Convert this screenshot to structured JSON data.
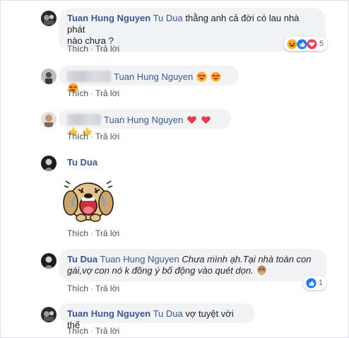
{
  "labels": {
    "like": "Thích",
    "reply": "Trả lời",
    "separator": "·"
  },
  "comments": [
    {
      "author": "Tuan Hung Nguyen",
      "mention": "Tu Dua",
      "text_line1": "thằng anh cả đời có lau nhà phát",
      "text_line2": "nào chưa ?",
      "reaction_count": "5"
    },
    {
      "author": "",
      "mention": "Tuan Hung Nguyen"
    },
    {
      "author": "",
      "mention": "Tuan Hung Nguyen"
    },
    {
      "author": "Tu Dua",
      "sticker": "crying-dog-sticker"
    },
    {
      "author": "Tu Dua",
      "mention": "Tuan Hung Nguyen",
      "text_line1": "Chưa mình ạh.Tại nhà toàn con",
      "text_line2": "gái,vợ con nó k đồng ý bố động vào quét dọn.",
      "reaction_count": "1"
    },
    {
      "author": "Tuan Hung Nguyen",
      "mention": "Tu Dua",
      "text_line1": "vợ tuyệt vời thế"
    }
  ],
  "colors": {
    "name": "#385898",
    "bubble": "#f2f3f5",
    "like_blue": "#1877f2",
    "love_red": "#f33e58",
    "haha_yellow": "#f7b125"
  }
}
